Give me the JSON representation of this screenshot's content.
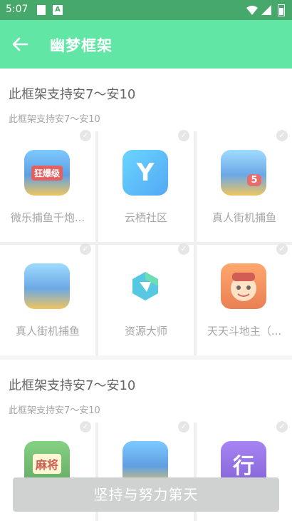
{
  "status_bar": {
    "time": "5:07",
    "a_label": "A"
  },
  "app_bar": {
    "title": "幽梦框架"
  },
  "sections": [
    {
      "title": "此框架支持安7～安10",
      "subtitle": "此框架支持安7～安10",
      "apps": [
        {
          "name": "微乐捕鱼千炮...",
          "icon": "shark-fish-game-icon",
          "icon_text": "狂爆级"
        },
        {
          "name": "云栖社区",
          "icon": "y-logo-icon",
          "icon_text": "Y"
        },
        {
          "name": "真人街机捕鱼",
          "icon": "shark-fish-game-icon",
          "icon_text": "5"
        },
        {
          "name": "真人街机捕鱼",
          "icon": "shark-fish-game-icon",
          "icon_text": ""
        },
        {
          "name": "资源大师",
          "icon": "hexagon-logo-icon",
          "icon_text": ""
        },
        {
          "name": "天天斗地主（...",
          "icon": "cartoon-face-icon",
          "icon_text": ""
        }
      ]
    },
    {
      "title": "此框架支持安7～安10",
      "subtitle": "此框架支持安7～安10",
      "apps": [
        {
          "name": "",
          "icon": "mahjong-game-icon",
          "icon_text": "麻将"
        },
        {
          "name": "",
          "icon": "shark-fish-game-icon",
          "icon_text": ""
        },
        {
          "name": "",
          "icon": "xing-logo-icon",
          "icon_text": "行"
        }
      ]
    }
  ],
  "bottom_button": {
    "label": "坚持与努力第天"
  },
  "colors": {
    "status_bar": "#46a86a",
    "app_bar": "#62e6a6",
    "button": "#cfd2d1"
  }
}
